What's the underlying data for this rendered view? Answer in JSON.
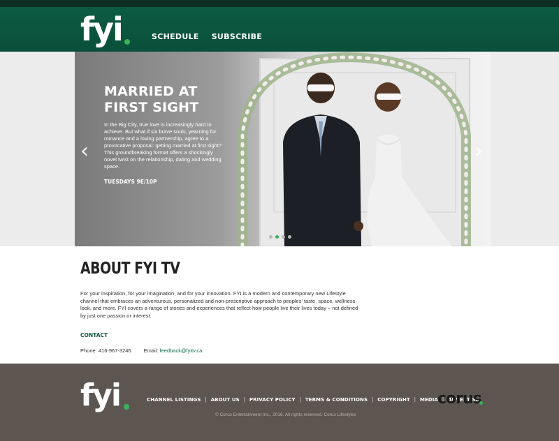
{
  "header": {
    "logo": "fyi",
    "nav": [
      "SCHEDULE",
      "SUBSCRIBE"
    ]
  },
  "hero": {
    "title": "MARRIED AT FIRST SIGHT",
    "description": "In the Big City, true love is increasingly hard to achieve. But what if six brave souls, yearning for romance and a loving partnership, agree to a provocative proposal: getting married at first sight? This groundbreaking format offers a shockingly novel twist on the relationship, dating and wedding space.",
    "time": "TUESDAYS 9E/10P",
    "prev_icon": "chevron-left-icon",
    "next_icon": "chevron-right-icon",
    "slides_count": 4,
    "active_slide": 2
  },
  "about": {
    "title": "ABOUT FYI TV",
    "body": "For your inspiration, for your imagination, and for your innovation. FYI is a modern and contemporary new Lifestyle channel that embraces an adventurous, personalized and non-prescriptive approach to peoples' taste, space, wellness, look, and more. FYI covers a range of stories and experiences that reflect how people live their lives today – not defined by just one passion or interest.",
    "contact_label": "CONTACT",
    "phone": "Phone: 416-967-3246",
    "email_label": "Email:",
    "email": "feedback@fyitv.ca"
  },
  "footer": {
    "logo": "fyi",
    "links": [
      "CHANNEL LISTINGS",
      "ABOUT US",
      "PRIVACY POLICY",
      "TERMS & CONDITIONS",
      "COPYRIGHT",
      "MEDIA",
      "ADVERTISE"
    ],
    "copyright": "© Corus Entertainment Inc., 2016. All rights reserved. Corus Lifestyles",
    "partner": "corus"
  },
  "colors": {
    "brand_green": "#0d5b43",
    "accent_green": "#3bb25a",
    "footer_bg": "#5d5650"
  }
}
